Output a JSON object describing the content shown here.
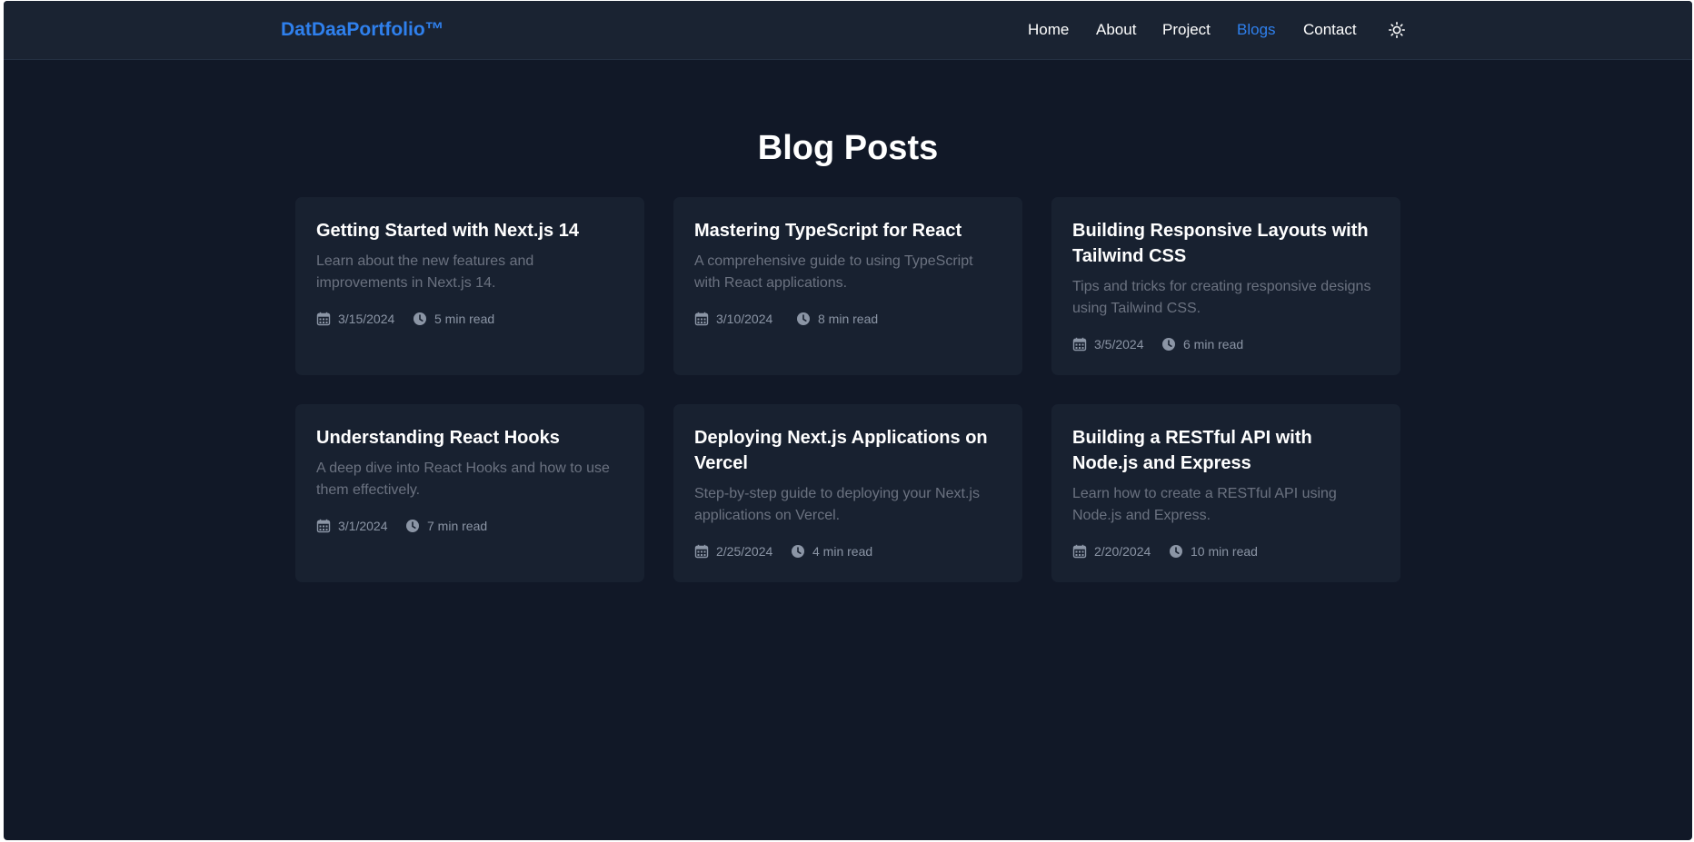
{
  "navbar": {
    "brand": "DatDaaPortfolio™",
    "links": [
      {
        "label": "Home"
      },
      {
        "label": "About"
      },
      {
        "label": "Project"
      },
      {
        "label": "Blogs"
      },
      {
        "label": "Contact"
      }
    ],
    "active_link": "Blogs",
    "theme_toggle_icon": "sun-icon"
  },
  "page": {
    "title": "Blog Posts"
  },
  "posts": [
    {
      "title": "Getting Started with Next.js 14",
      "description": "Learn about the new features and improvements in Next.js 14.",
      "date": "3/15/2024",
      "read_time": "5 min read"
    },
    {
      "title": "Mastering TypeScript for React",
      "description": "A comprehensive guide to using TypeScript with React applications.",
      "date": "3/10/2024",
      "read_time": "8 min read"
    },
    {
      "title": "Building Responsive Layouts with Tailwind CSS",
      "description": "Tips and tricks for creating responsive designs using Tailwind CSS.",
      "date": "3/5/2024",
      "read_time": "6 min read"
    },
    {
      "title": "Understanding React Hooks",
      "description": "A deep dive into React Hooks and how to use them effectively.",
      "date": "3/1/2024",
      "read_time": "7 min read"
    },
    {
      "title": "Deploying Next.js Applications on Vercel",
      "description": "Step-by-step guide to deploying your Next.js applications on Vercel.",
      "date": "2/25/2024",
      "read_time": "4 min read"
    },
    {
      "title": "Building a RESTful API with Node.js and Express",
      "description": "Learn how to create a RESTful API using Node.js and Express.",
      "date": "2/20/2024",
      "read_time": "10 min read"
    }
  ],
  "colors": {
    "background": "#111827",
    "navbar": "#1a2332",
    "card": "#182130",
    "accent": "#2f80ed",
    "muted_text": "#6b7280",
    "meta_text": "#8b95a5"
  }
}
